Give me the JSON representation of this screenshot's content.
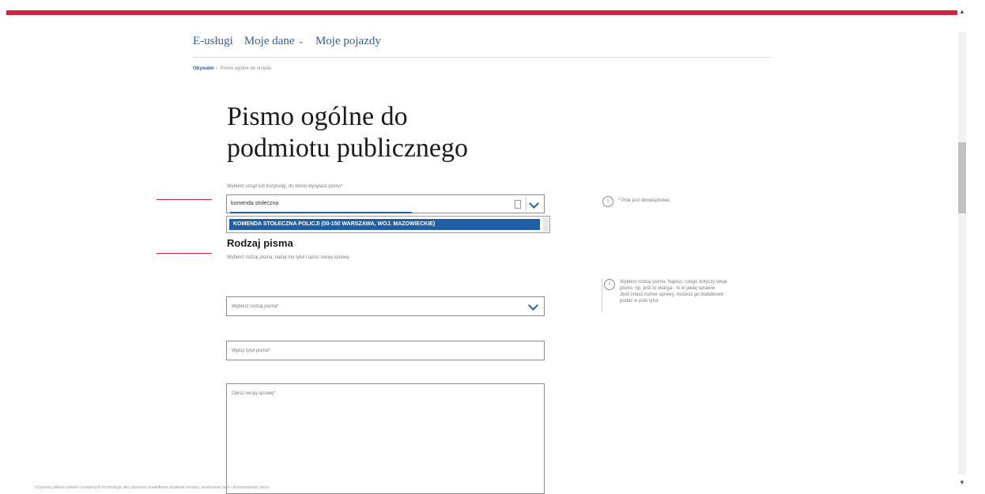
{
  "nav": {
    "items": [
      {
        "label": "E-usługi",
        "has_dropdown": false
      },
      {
        "label": "Moje dane",
        "has_dropdown": true
      },
      {
        "label": "Moje pojazdy",
        "has_dropdown": false
      }
    ]
  },
  "breadcrumb": {
    "home": "Obywatel",
    "separator": "/",
    "current": "Pismo ogólne do urzędu"
  },
  "page": {
    "title_line1": "Pismo ogólne do",
    "title_line2": "podmiotu publicznego"
  },
  "recipient": {
    "label": "Wybierz urząd lub instytucję, do której wysyłasz pismo*",
    "value": "komenda stołeczna",
    "suggestion": "KOMENDA STOŁECZNA POLICJI (00-150 WARSZAWA, WOJ. MAZOWIECKIE)"
  },
  "info": {
    "required_note": "* Pole jest obowiązkowe.",
    "type_hint_line1": "Wybierz rodzaj pisma. Napisz, czego dotyczy twoje",
    "type_hint_line2": "pismo, np. jeśli to skarga - to w jakiej sprawie.",
    "type_hint_line3": "Jeśli znasz numer sprawy, możesz go dodatkowo",
    "type_hint_line4": "podać w polu tytuł."
  },
  "letter_type": {
    "heading": "Rodzaj pisma",
    "description": "Wybierz rodzaj pisma, nadaj mu tytuł i opisz swoją sprawę",
    "select_placeholder": "Wybierz rodzaj pisma*",
    "title_placeholder": "Wpisz tytuł pisma*",
    "description_placeholder": "Opisz swoją sprawę*"
  },
  "footer": {
    "text": "Używamy plików cookies i podobnych technologii, aby zapewnić prawidłowe działanie serwisu, analizować ruch i dostosowywać treści."
  },
  "colors": {
    "accent_red": "#d4213d",
    "link_blue": "#2c5ea6",
    "highlight_blue": "#1f5fa8"
  }
}
